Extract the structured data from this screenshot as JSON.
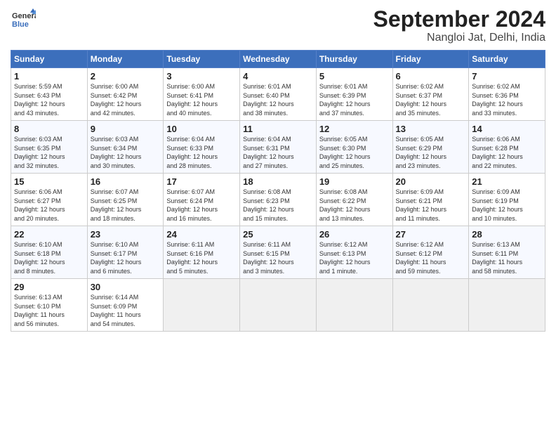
{
  "logo": {
    "line1": "General",
    "line2": "Blue"
  },
  "header": {
    "month": "September 2024",
    "location": "Nangloi Jat, Delhi, India"
  },
  "weekdays": [
    "Sunday",
    "Monday",
    "Tuesday",
    "Wednesday",
    "Thursday",
    "Friday",
    "Saturday"
  ],
  "weeks": [
    [
      {
        "day": "1",
        "info": "Sunrise: 5:59 AM\nSunset: 6:43 PM\nDaylight: 12 hours\nand 43 minutes."
      },
      {
        "day": "2",
        "info": "Sunrise: 6:00 AM\nSunset: 6:42 PM\nDaylight: 12 hours\nand 42 minutes."
      },
      {
        "day": "3",
        "info": "Sunrise: 6:00 AM\nSunset: 6:41 PM\nDaylight: 12 hours\nand 40 minutes."
      },
      {
        "day": "4",
        "info": "Sunrise: 6:01 AM\nSunset: 6:40 PM\nDaylight: 12 hours\nand 38 minutes."
      },
      {
        "day": "5",
        "info": "Sunrise: 6:01 AM\nSunset: 6:39 PM\nDaylight: 12 hours\nand 37 minutes."
      },
      {
        "day": "6",
        "info": "Sunrise: 6:02 AM\nSunset: 6:37 PM\nDaylight: 12 hours\nand 35 minutes."
      },
      {
        "day": "7",
        "info": "Sunrise: 6:02 AM\nSunset: 6:36 PM\nDaylight: 12 hours\nand 33 minutes."
      }
    ],
    [
      {
        "day": "8",
        "info": "Sunrise: 6:03 AM\nSunset: 6:35 PM\nDaylight: 12 hours\nand 32 minutes."
      },
      {
        "day": "9",
        "info": "Sunrise: 6:03 AM\nSunset: 6:34 PM\nDaylight: 12 hours\nand 30 minutes."
      },
      {
        "day": "10",
        "info": "Sunrise: 6:04 AM\nSunset: 6:33 PM\nDaylight: 12 hours\nand 28 minutes."
      },
      {
        "day": "11",
        "info": "Sunrise: 6:04 AM\nSunset: 6:31 PM\nDaylight: 12 hours\nand 27 minutes."
      },
      {
        "day": "12",
        "info": "Sunrise: 6:05 AM\nSunset: 6:30 PM\nDaylight: 12 hours\nand 25 minutes."
      },
      {
        "day": "13",
        "info": "Sunrise: 6:05 AM\nSunset: 6:29 PM\nDaylight: 12 hours\nand 23 minutes."
      },
      {
        "day": "14",
        "info": "Sunrise: 6:06 AM\nSunset: 6:28 PM\nDaylight: 12 hours\nand 22 minutes."
      }
    ],
    [
      {
        "day": "15",
        "info": "Sunrise: 6:06 AM\nSunset: 6:27 PM\nDaylight: 12 hours\nand 20 minutes."
      },
      {
        "day": "16",
        "info": "Sunrise: 6:07 AM\nSunset: 6:25 PM\nDaylight: 12 hours\nand 18 minutes."
      },
      {
        "day": "17",
        "info": "Sunrise: 6:07 AM\nSunset: 6:24 PM\nDaylight: 12 hours\nand 16 minutes."
      },
      {
        "day": "18",
        "info": "Sunrise: 6:08 AM\nSunset: 6:23 PM\nDaylight: 12 hours\nand 15 minutes."
      },
      {
        "day": "19",
        "info": "Sunrise: 6:08 AM\nSunset: 6:22 PM\nDaylight: 12 hours\nand 13 minutes."
      },
      {
        "day": "20",
        "info": "Sunrise: 6:09 AM\nSunset: 6:21 PM\nDaylight: 12 hours\nand 11 minutes."
      },
      {
        "day": "21",
        "info": "Sunrise: 6:09 AM\nSunset: 6:19 PM\nDaylight: 12 hours\nand 10 minutes."
      }
    ],
    [
      {
        "day": "22",
        "info": "Sunrise: 6:10 AM\nSunset: 6:18 PM\nDaylight: 12 hours\nand 8 minutes."
      },
      {
        "day": "23",
        "info": "Sunrise: 6:10 AM\nSunset: 6:17 PM\nDaylight: 12 hours\nand 6 minutes."
      },
      {
        "day": "24",
        "info": "Sunrise: 6:11 AM\nSunset: 6:16 PM\nDaylight: 12 hours\nand 5 minutes."
      },
      {
        "day": "25",
        "info": "Sunrise: 6:11 AM\nSunset: 6:15 PM\nDaylight: 12 hours\nand 3 minutes."
      },
      {
        "day": "26",
        "info": "Sunrise: 6:12 AM\nSunset: 6:13 PM\nDaylight: 12 hours\nand 1 minute."
      },
      {
        "day": "27",
        "info": "Sunrise: 6:12 AM\nSunset: 6:12 PM\nDaylight: 11 hours\nand 59 minutes."
      },
      {
        "day": "28",
        "info": "Sunrise: 6:13 AM\nSunset: 6:11 PM\nDaylight: 11 hours\nand 58 minutes."
      }
    ],
    [
      {
        "day": "29",
        "info": "Sunrise: 6:13 AM\nSunset: 6:10 PM\nDaylight: 11 hours\nand 56 minutes."
      },
      {
        "day": "30",
        "info": "Sunrise: 6:14 AM\nSunset: 6:09 PM\nDaylight: 11 hours\nand 54 minutes."
      },
      {
        "day": "",
        "info": ""
      },
      {
        "day": "",
        "info": ""
      },
      {
        "day": "",
        "info": ""
      },
      {
        "day": "",
        "info": ""
      },
      {
        "day": "",
        "info": ""
      }
    ]
  ]
}
